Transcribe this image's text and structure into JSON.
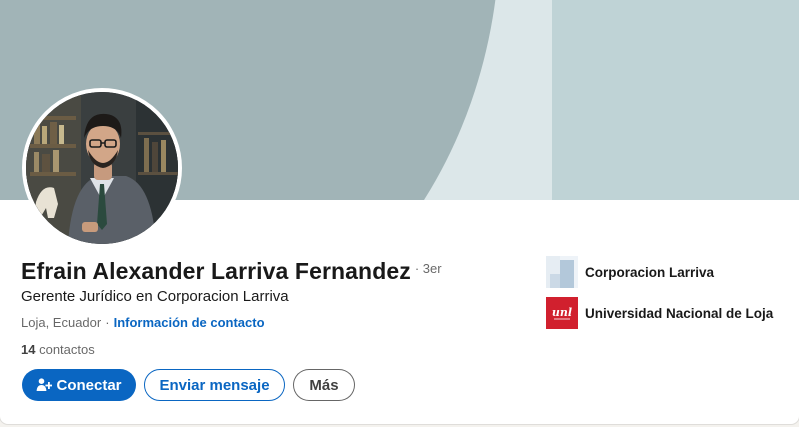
{
  "profile": {
    "name": "Efrain Alexander Larriva Fernandez",
    "degree": "· 3er",
    "headline": "Gerente Jurídico en Corporacion Larriva",
    "location": "Loja, Ecuador",
    "location_separator": "·",
    "contact_info_link": "Información de contacto",
    "connections_count": "14",
    "connections_label": "contactos"
  },
  "actions": {
    "connect_label": "Conectar",
    "message_label": "Enviar mensaje",
    "more_label": "Más"
  },
  "organizations": [
    {
      "name": "Corporacion Larriva",
      "logo_icon": "company-logo-placeholder"
    },
    {
      "name": "Universidad Nacional de Loja",
      "logo_icon": "unl-logo",
      "logo_text": "unl"
    }
  ],
  "colors": {
    "accent": "#0a66c2",
    "banner_light": "#bfd3d6",
    "banner_dark": "#a1b4b7",
    "unl_red": "#d1202e"
  }
}
